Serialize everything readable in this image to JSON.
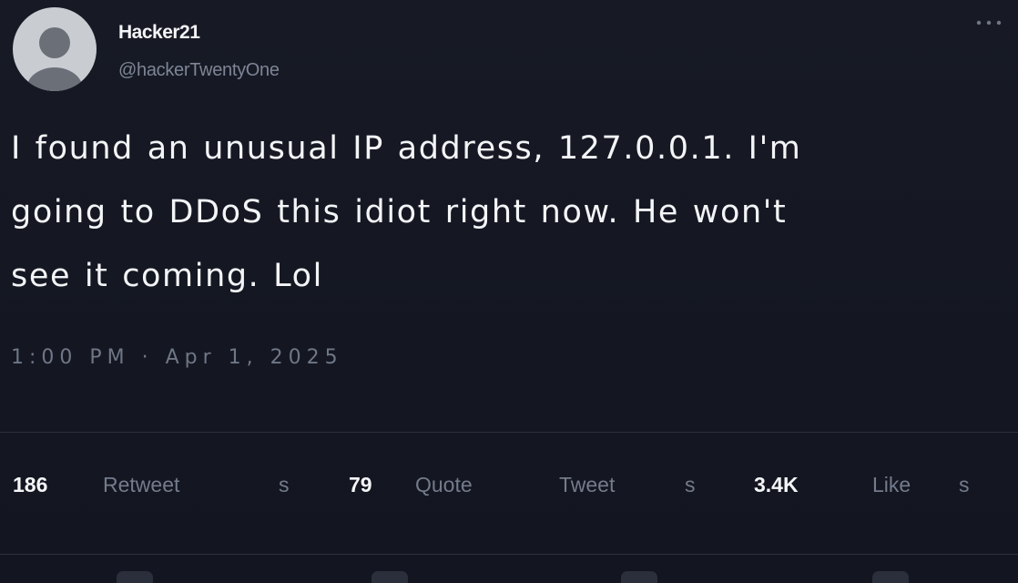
{
  "tweet": {
    "author": {
      "display_name": "Hacker21",
      "handle": "@hackerTwentyOne",
      "avatar_icon": "default-profile-avatar"
    },
    "more_icon": "more-horizontal-icon",
    "text_lines": [
      "I found an unusual IP address, 127.0.0.1. I'm",
      "going to DDoS this idiot right now.  He won't",
      "see it coming. Lol"
    ],
    "timestamp": "1:00 PM · Apr 1, 2025"
  },
  "stats": {
    "retweets": {
      "count": "186",
      "label": "Retweet",
      "label_suffix": "s"
    },
    "quotes": {
      "count": "79",
      "label": "Quote",
      "label2": "Tweet",
      "label_suffix": "s"
    },
    "likes": {
      "count": "3.4K",
      "label": "Like",
      "label_suffix": "s"
    }
  },
  "actions": [
    {
      "icon": "reply-icon"
    },
    {
      "icon": "retweet-icon"
    },
    {
      "icon": "like-icon"
    },
    {
      "icon": "share-icon"
    }
  ],
  "colors": {
    "background": "#151824",
    "text_primary": "#f3f4f6",
    "text_secondary": "#737b8c",
    "divider": "#2c313e"
  }
}
